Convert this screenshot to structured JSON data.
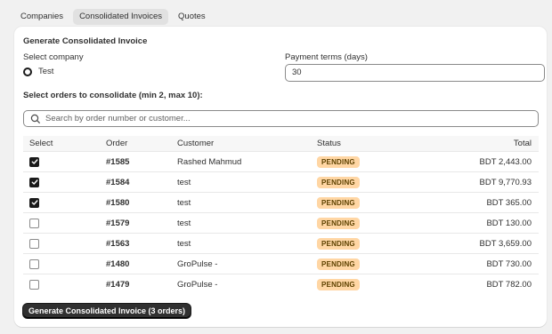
{
  "tabs": [
    {
      "label": "Companies",
      "active": false
    },
    {
      "label": "Consolidated Invoices",
      "active": true
    },
    {
      "label": "Quotes",
      "active": false
    }
  ],
  "form": {
    "title": "Generate Consolidated Invoice",
    "company_label": "Select company",
    "company_option": "Test",
    "payment_terms_label": "Payment terms (days)",
    "payment_terms_value": "30",
    "orders_label": "Select orders to consolidate (min 2, max 10):",
    "search_placeholder": "Search by order number or customer...",
    "generate_button": "Generate Consolidated Invoice (3 orders)"
  },
  "table": {
    "headers": [
      "Select",
      "Order",
      "Customer",
      "Status",
      "Total"
    ],
    "rows": [
      {
        "checked": true,
        "order": "#1585",
        "customer": "Rashed Mahmud",
        "status": "PENDING",
        "total": "BDT 2,443.00"
      },
      {
        "checked": true,
        "order": "#1584",
        "customer": "test",
        "status": "PENDING",
        "total": "BDT 9,770.93"
      },
      {
        "checked": true,
        "order": "#1580",
        "customer": "test",
        "status": "PENDING",
        "total": "BDT 365.00"
      },
      {
        "checked": false,
        "order": "#1579",
        "customer": "test",
        "status": "PENDING",
        "total": "BDT 130.00"
      },
      {
        "checked": false,
        "order": "#1563",
        "customer": "test",
        "status": "PENDING",
        "total": "BDT 3,659.00"
      },
      {
        "checked": false,
        "order": "#1480",
        "customer": "GroPulse -",
        "status": "PENDING",
        "total": "BDT 730.00"
      },
      {
        "checked": false,
        "order": "#1479",
        "customer": "GroPulse -",
        "status": "PENDING",
        "total": "BDT 782.00"
      }
    ]
  },
  "colors": {
    "badge_bg": "#ffd6a4",
    "badge_text": "#5e4200",
    "primary_button": "#303030"
  },
  "icons": {
    "search": "search-icon",
    "checkmark": "checkmark-icon",
    "radio": "radio-selected-icon"
  }
}
